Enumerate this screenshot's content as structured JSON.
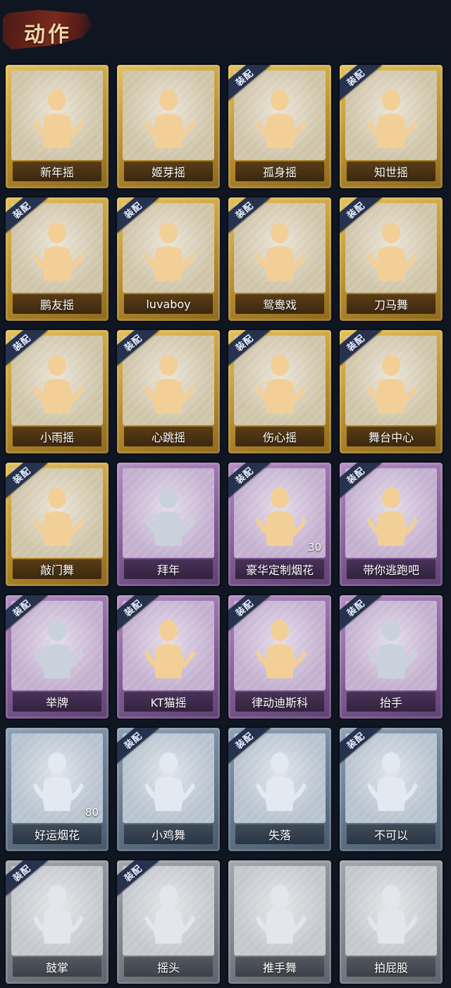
{
  "section_title": "动作",
  "badge_text": "装配",
  "rarity_colors": {
    "gold": "#c9a23f",
    "purple": "#8f6aa5",
    "blue": "#6f8398",
    "grey": "#868b93"
  },
  "items": [
    {
      "label": "新年摇",
      "rarity": "gold",
      "equipped": false,
      "icon": "pose-figure-icon"
    },
    {
      "label": "姬芽摇",
      "rarity": "gold",
      "equipped": false,
      "icon": "pose-figure-icon"
    },
    {
      "label": "孤身摇",
      "rarity": "gold",
      "equipped": true,
      "icon": "pose-figure-icon"
    },
    {
      "label": "知世摇",
      "rarity": "gold",
      "equipped": true,
      "icon": "pose-figure-icon"
    },
    {
      "label": "鹏友摇",
      "rarity": "gold",
      "equipped": true,
      "icon": "pose-figure-icon"
    },
    {
      "label": "luvaboy",
      "rarity": "gold",
      "equipped": true,
      "icon": "pose-figure-icon"
    },
    {
      "label": "鸳鸯戏",
      "rarity": "gold",
      "equipped": true,
      "icon": "pose-figure-icon"
    },
    {
      "label": "刀马舞",
      "rarity": "gold",
      "equipped": true,
      "icon": "pose-figure-icon"
    },
    {
      "label": "小雨摇",
      "rarity": "gold",
      "equipped": true,
      "icon": "pose-figure-icon"
    },
    {
      "label": "心跳摇",
      "rarity": "gold",
      "equipped": true,
      "icon": "pose-figure-icon"
    },
    {
      "label": "伤心摇",
      "rarity": "gold",
      "equipped": true,
      "icon": "heart-hands-figure-icon"
    },
    {
      "label": "舞台中心",
      "rarity": "gold",
      "equipped": true,
      "icon": "pose-figure-icon"
    },
    {
      "label": "敲门舞",
      "rarity": "gold",
      "equipped": true,
      "icon": "pose-figure-icon"
    },
    {
      "label": "拜年",
      "rarity": "purple",
      "equipped": false,
      "icon": "bow-figure-icon",
      "dim": true
    },
    {
      "label": "豪华定制烟花",
      "rarity": "purple",
      "equipped": true,
      "icon": "fireworks-icon",
      "count": "30"
    },
    {
      "label": "带你逃跑吧",
      "rarity": "purple",
      "equipped": true,
      "icon": "pose-figure-icon"
    },
    {
      "label": "举牌",
      "rarity": "purple",
      "equipped": true,
      "icon": "sign-figure-icon",
      "dim": true
    },
    {
      "label": "KT猫摇",
      "rarity": "purple",
      "equipped": true,
      "icon": "pose-figure-icon"
    },
    {
      "label": "律动迪斯科",
      "rarity": "purple",
      "equipped": true,
      "icon": "disco-figure-icon"
    },
    {
      "label": "抬手",
      "rarity": "purple",
      "equipped": true,
      "icon": "raise-hand-figure-icon",
      "dim": true
    },
    {
      "label": "好运烟花",
      "rarity": "blue",
      "equipped": false,
      "icon": "firecracker-icon",
      "count": "80"
    },
    {
      "label": "小鸡舞",
      "rarity": "blue",
      "equipped": true,
      "icon": "pose-figure-icon"
    },
    {
      "label": "失落",
      "rarity": "blue",
      "equipped": true,
      "icon": "crawl-figure-icon"
    },
    {
      "label": "不可以",
      "rarity": "blue",
      "equipped": true,
      "icon": "finger-wag-icon"
    },
    {
      "label": "鼓掌",
      "rarity": "grey",
      "equipped": true,
      "icon": "clap-hands-icon"
    },
    {
      "label": "摇头",
      "rarity": "grey",
      "equipped": true,
      "icon": "pose-figure-icon"
    },
    {
      "label": "推手舞",
      "rarity": "grey",
      "equipped": false,
      "icon": "pose-figure-icon"
    },
    {
      "label": "拍屁股",
      "rarity": "grey",
      "equipped": false,
      "icon": "pose-figure-icon"
    }
  ]
}
